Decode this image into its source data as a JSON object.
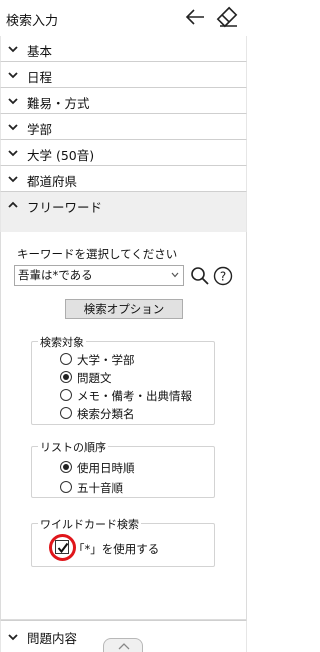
{
  "title": "検索入力",
  "sections": [
    {
      "label": "基本",
      "state": "collapsed"
    },
    {
      "label": "日程",
      "state": "collapsed"
    },
    {
      "label": "難易・方式",
      "state": "collapsed"
    },
    {
      "label": "学部",
      "state": "collapsed"
    },
    {
      "label": "大学 (50音)",
      "state": "collapsed"
    },
    {
      "label": "都道府県",
      "state": "collapsed"
    },
    {
      "label": "フリーワード",
      "state": "expanded"
    }
  ],
  "freeword": {
    "keyword_label": "キーワードを選択してください",
    "keyword_value": "吾輩は*である",
    "options_button": "検索オプション",
    "search_target": {
      "legend": "検索対象",
      "options": [
        {
          "label": "大学・学部",
          "selected": false
        },
        {
          "label": "問題文",
          "selected": true
        },
        {
          "label": "メモ・備考・出典情報",
          "selected": false
        },
        {
          "label": "検索分類名",
          "selected": false
        }
      ]
    },
    "list_order": {
      "legend": "リストの順序",
      "options": [
        {
          "label": "使用日時順",
          "selected": true
        },
        {
          "label": "五十音順",
          "selected": false
        }
      ]
    },
    "wildcard": {
      "legend": "ワイルドカード検索",
      "checkbox_label": "「*」を使用する",
      "checked": true
    }
  },
  "bottom_section": {
    "label": "問題内容",
    "state": "collapsed"
  },
  "colors": {
    "highlight_ring": "#e0161b",
    "button_bg": "#e1e1e1"
  }
}
